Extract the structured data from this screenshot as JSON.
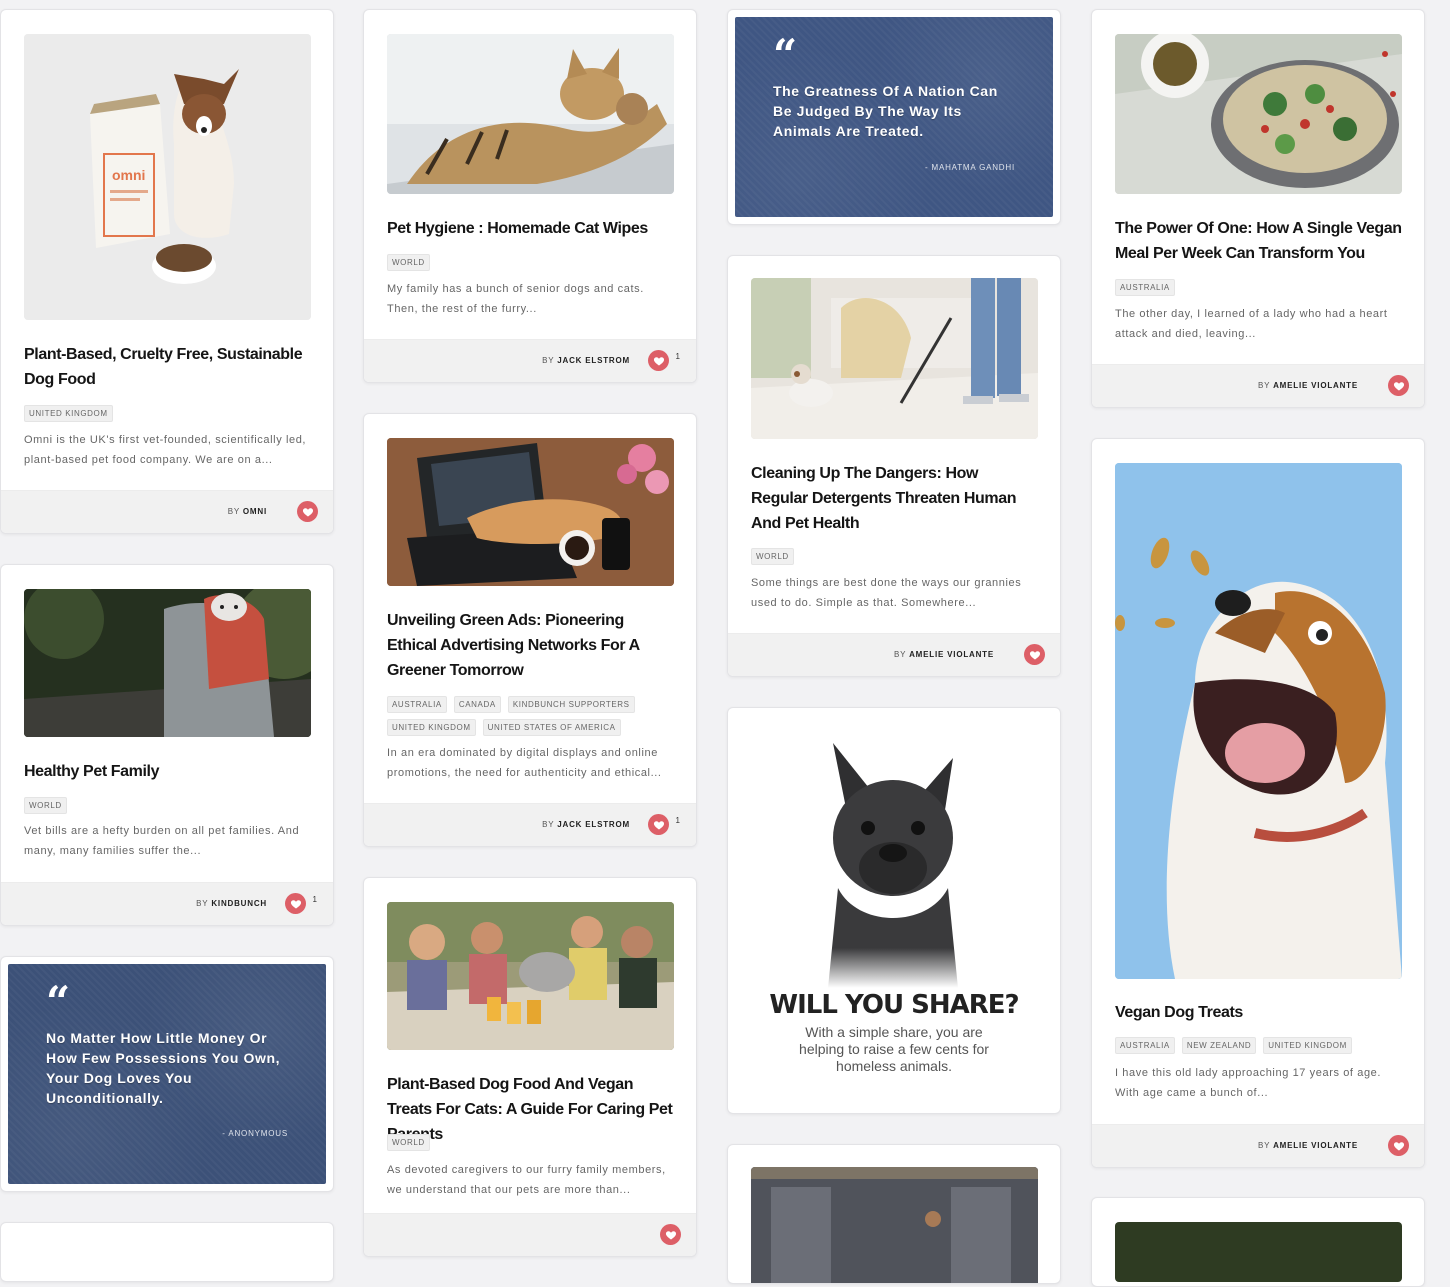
{
  "colors": {
    "accent": "#dd5f67",
    "quote_bg": "#3c5178",
    "footer_bg": "#f1f1f1"
  },
  "by_prefix": "BY",
  "cards": {
    "dog_food": {
      "title": "Plant-Based, Cruelty Free, Sustainable Dog Food",
      "tags": [
        "UNITED KINGDOM"
      ],
      "excerpt": "Omni is the UK's first vet-founded, scientifically led, plant-based pet food company. We are on a...",
      "author": "OMNI",
      "bag_label": "omni"
    },
    "healthy_family": {
      "title": "Healthy Pet Family",
      "tags": [
        "WORLD"
      ],
      "excerpt": "Vet bills are a hefty burden on all pet families.  And many, many families suffer the...",
      "author": "KINDBUNCH",
      "likes": "1"
    },
    "quote_money": {
      "text": "No Matter How Little Money Or How Few Possessions You Own, Your Dog Loves You Unconditionally.",
      "author": "- ANONYMOUS"
    },
    "cat_wipes": {
      "title": "Pet Hygiene : Homemade Cat Wipes",
      "tags": [
        "WORLD"
      ],
      "excerpt": "My family has a bunch of senior dogs and cats. Then, the rest of the furry...",
      "author": "JACK ELSTROM",
      "likes": "1"
    },
    "green_ads": {
      "title": "Unveiling Green Ads: Pioneering Ethical Advertising Networks For A Greener Tomorrow",
      "tags": [
        "AUSTRALIA",
        "CANADA",
        "KINDBUNCH SUPPORTERS",
        "UNITED KINGDOM",
        "UNITED STATES OF AMERICA"
      ],
      "excerpt": "In an era dominated by digital displays and online promotions, the need for authenticity and ethical...",
      "author": "JACK ELSTROM",
      "likes": "1"
    },
    "plant_guide": {
      "title": "Plant-Based Dog Food And Vegan Treats For Cats: A Guide For Caring Pet Parents",
      "tags": [
        "WORLD"
      ],
      "excerpt": "As devoted caregivers to our furry family members, we understand that our pets are more than..."
    },
    "quote_gandhi": {
      "text": "The Greatness Of A Nation Can Be Judged By The Way Its Animals Are Treated.",
      "author": "- MAHATMA GANDHI"
    },
    "detergents": {
      "title": "Cleaning Up The Dangers: How Regular Detergents Threaten Human And Pet Health",
      "tags": [
        "WORLD"
      ],
      "excerpt": "Some things are best done the ways our grannies used to do. Simple as that. Somewhere...",
      "author": "AMELIE VIOLANTE"
    },
    "share": {
      "title": "WILL YOU SHARE?",
      "text": "With a simple share, you are helping to raise a few cents for homeless animals."
    },
    "vegan_meal": {
      "title": "The Power Of One: How A Single Vegan Meal Per Week Can Transform You",
      "tags": [
        "AUSTRALIA"
      ],
      "excerpt": "The other day, I learned of a lady who had a heart attack and died, leaving...",
      "author": "AMELIE VIOLANTE"
    },
    "dog_treats": {
      "title": "Vegan Dog Treats",
      "tags": [
        "AUSTRALIA",
        "NEW ZEALAND",
        "UNITED KINGDOM"
      ],
      "excerpt": "I have this old lady approaching 17 years of age. With age came a bunch of...",
      "author": "AMELIE VIOLANTE"
    }
  }
}
